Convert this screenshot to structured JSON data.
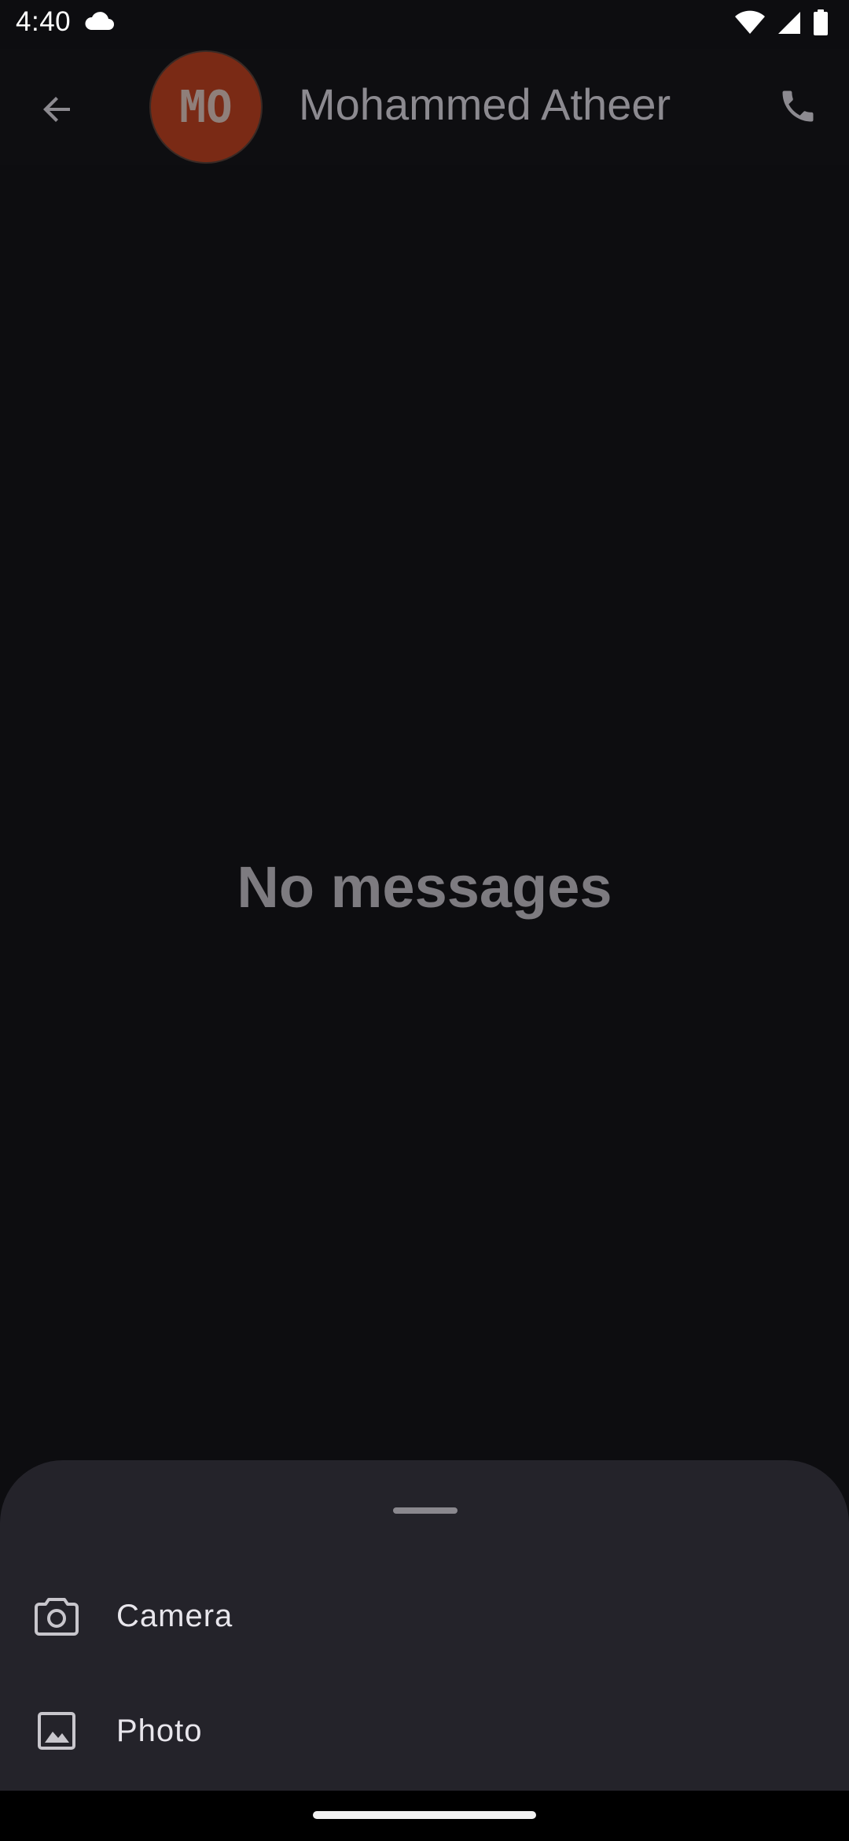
{
  "status_bar": {
    "time": "4:40",
    "icons": [
      "cloud-icon",
      "wifi-icon",
      "signal-icon",
      "battery-icon"
    ]
  },
  "app_bar": {
    "back_icon": "arrow-back-icon",
    "avatar_initials": "MO",
    "avatar_color": "#7a2a15",
    "contact_name": "Mohammed Atheer",
    "call_icon": "phone-icon"
  },
  "conversation": {
    "empty_text": "No messages"
  },
  "attachment_sheet": {
    "items": [
      {
        "label": "Camera",
        "icon": "camera-icon"
      },
      {
        "label": "Photo",
        "icon": "image-icon"
      }
    ]
  },
  "colors": {
    "background": "#0d0d10",
    "sheet": "#24232a",
    "text_primary": "#e8e6ec",
    "text_dimmed": "#8c8a90"
  }
}
